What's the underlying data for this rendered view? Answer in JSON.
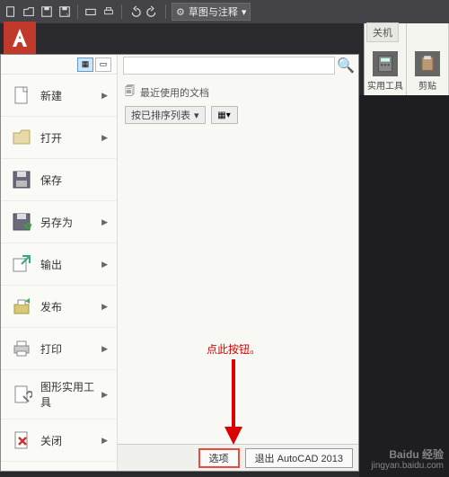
{
  "qat": {
    "workspace_label": "草图与注释"
  },
  "ribbon": {
    "tab_label": "关机",
    "panel1_label": "实用工具",
    "panel2_label": "剪贴"
  },
  "app_menu": {
    "search_placeholder": "",
    "recent_title": "最近使用的文档",
    "sort_label": "按已排序列表",
    "items": [
      {
        "label": "新建",
        "icon": "new"
      },
      {
        "label": "打开",
        "icon": "open"
      },
      {
        "label": "保存",
        "icon": "save"
      },
      {
        "label": "另存为",
        "icon": "saveas"
      },
      {
        "label": "输出",
        "icon": "export"
      },
      {
        "label": "发布",
        "icon": "publish"
      },
      {
        "label": "打印",
        "icon": "print"
      },
      {
        "label": "图形实用工具",
        "icon": "tools"
      },
      {
        "label": "关闭",
        "icon": "close"
      }
    ],
    "footer": {
      "options_label": "选项",
      "exit_label": "退出 AutoCAD 2013"
    }
  },
  "annotation_text": "点此按钮。",
  "watermark": {
    "brand": "Baidu 经验",
    "url": "jingyan.baidu.com"
  }
}
